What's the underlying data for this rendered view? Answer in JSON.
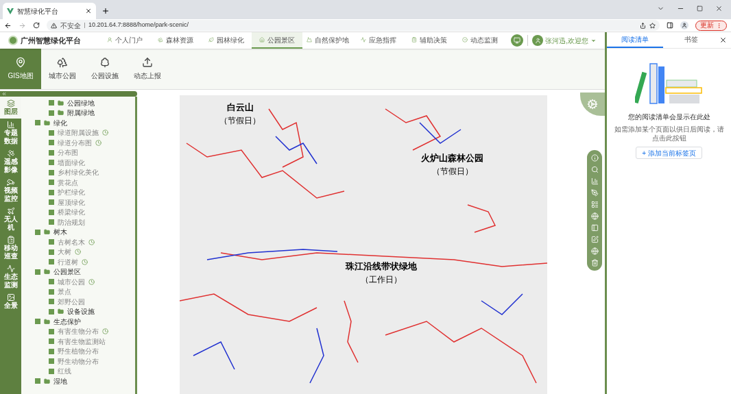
{
  "browser": {
    "tab_title": "智慧绿化平台",
    "security": "不安全",
    "url": "10.201.64.7:8888/home/park-scenic/",
    "update_button": "更新"
  },
  "header": {
    "app_title": "广州智慧绿化平台",
    "user": "张河迅,欢迎您"
  },
  "nav": [
    {
      "label": "个人门户",
      "selected": false
    },
    {
      "label": "森林资源",
      "selected": false
    },
    {
      "label": "园林绿化",
      "selected": false
    },
    {
      "label": "公园景区",
      "selected": true
    },
    {
      "label": "自然保护地",
      "selected": false
    },
    {
      "label": "应急指挥",
      "selected": false
    },
    {
      "label": "辅助决策",
      "selected": false
    },
    {
      "label": "动态监测",
      "selected": false
    }
  ],
  "subnav": [
    {
      "label": "GIS地图",
      "selected": true
    },
    {
      "label": "城市公园",
      "selected": false
    },
    {
      "label": "公园设施",
      "selected": false
    },
    {
      "label": "动态上报",
      "selected": false
    }
  ],
  "side_tabs": [
    {
      "label": "图层",
      "selected": true
    },
    {
      "label": "专题数据",
      "selected": false
    },
    {
      "label": "遥感影像",
      "selected": false
    },
    {
      "label": "视频监控",
      "selected": false
    },
    {
      "label": "无人机",
      "selected": false
    },
    {
      "label": "移动巡查",
      "selected": false
    },
    {
      "label": "生态监测",
      "selected": false
    },
    {
      "label": "全景",
      "selected": false
    }
  ],
  "tree": [
    {
      "kind": "subfolder",
      "label": "公园绿地",
      "checked": true
    },
    {
      "kind": "subfolder",
      "label": "附属绿地",
      "checked": true
    },
    {
      "kind": "folder",
      "label": "绿化",
      "checked": true,
      "children": [
        {
          "kind": "layer",
          "label": "绿道附属设施",
          "checked": true,
          "timed": true
        },
        {
          "kind": "layer",
          "label": "绿道分布图",
          "checked": true,
          "timed": true
        },
        {
          "kind": "layer",
          "label": "分布图",
          "checked": true,
          "timed": false
        },
        {
          "kind": "layer",
          "label": "墙面绿化",
          "checked": true,
          "timed": false
        },
        {
          "kind": "layer",
          "label": "乡村绿化美化",
          "checked": true,
          "timed": false
        },
        {
          "kind": "layer",
          "label": "赏花点",
          "checked": true,
          "timed": false
        },
        {
          "kind": "layer",
          "label": "护栏绿化",
          "checked": true,
          "timed": false
        },
        {
          "kind": "layer",
          "label": "屋顶绿化",
          "checked": true,
          "timed": false
        },
        {
          "kind": "layer",
          "label": "桥梁绿化",
          "checked": true,
          "timed": false
        },
        {
          "kind": "layer",
          "label": "防治规划",
          "checked": true,
          "timed": false
        }
      ]
    },
    {
      "kind": "folder",
      "label": "树木",
      "checked": true,
      "children": [
        {
          "kind": "layer",
          "label": "古树名木",
          "checked": true,
          "timed": true
        },
        {
          "kind": "layer",
          "label": "大树",
          "checked": true,
          "timed": true
        },
        {
          "kind": "layer",
          "label": "行道树",
          "checked": true,
          "timed": true
        }
      ]
    },
    {
      "kind": "folder",
      "label": "公园景区",
      "checked": true,
      "children": [
        {
          "kind": "layer",
          "label": "城市公园",
          "checked": true,
          "timed": true
        },
        {
          "kind": "layer",
          "label": "景点",
          "checked": true,
          "timed": false
        },
        {
          "kind": "layer",
          "label": "郊野公园",
          "checked": true,
          "timed": false
        },
        {
          "kind": "folder",
          "label": "设备设施",
          "checked": true
        }
      ]
    },
    {
      "kind": "folder",
      "label": "生态保护",
      "checked": true,
      "children": [
        {
          "kind": "layer",
          "label": "有害生物分布",
          "checked": true,
          "timed": true
        },
        {
          "kind": "layer",
          "label": "有害生物监测站",
          "checked": true,
          "timed": false
        },
        {
          "kind": "layer",
          "label": "野生植物分布",
          "checked": true,
          "timed": false
        },
        {
          "kind": "layer",
          "label": "野生动物分布",
          "checked": true,
          "timed": false
        },
        {
          "kind": "layer",
          "label": "红线",
          "checked": true,
          "timed": false
        }
      ]
    },
    {
      "kind": "folder",
      "label": "湿地",
      "checked": true
    }
  ],
  "map_labels": [
    {
      "name": "白云山",
      "note": "（节假日）"
    },
    {
      "name": "火炉山森林公园",
      "note": "（节假日）"
    },
    {
      "name": "珠江沿线带状绿地",
      "note": "（工作日）"
    }
  ],
  "reading_panel": {
    "tabs": [
      {
        "label": "阅读清单",
        "selected": true
      },
      {
        "label": "书签",
        "selected": false
      }
    ],
    "title": "您的阅读清单会显示在此处",
    "description": "如需添加某个页面以供日后阅读，请点击此按钮",
    "add_button": "+ 添加当前标签页"
  }
}
